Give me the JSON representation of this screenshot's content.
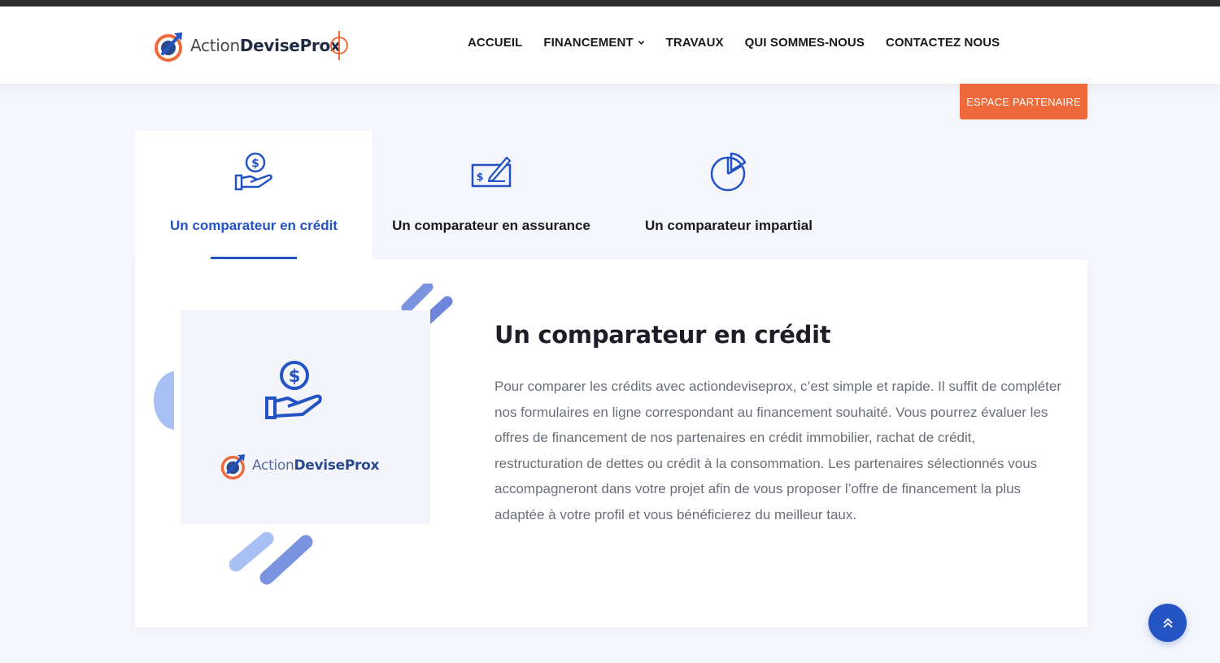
{
  "site": {
    "logo_text_light": "Action",
    "logo_text_bold": "DeviseProx"
  },
  "nav": {
    "items": [
      {
        "label": "ACCUEIL",
        "dropdown": false
      },
      {
        "label": "FINANCEMENT",
        "dropdown": true
      },
      {
        "label": "TRAVAUX",
        "dropdown": false
      },
      {
        "label": "QUI SOMMES-NOUS",
        "dropdown": false
      },
      {
        "label": "CONTACTEZ NOUS",
        "dropdown": false
      }
    ]
  },
  "partner_button": {
    "label": "ESPACE PARTENAIRE"
  },
  "tabs": [
    {
      "label": "Un comparateur en crédit",
      "icon": "hand-dollar-icon",
      "active": true
    },
    {
      "label": "Un comparateur en assurance",
      "icon": "cheque-icon",
      "active": false
    },
    {
      "label": "Un comparateur impartial",
      "icon": "pie-chart-icon",
      "active": false
    }
  ],
  "panel": {
    "title": "Un comparateur en crédit",
    "body": "Pour comparer les crédits avec actiondeviseprox, c’est simple et rapide. Il suffit de compléter nos formulaires en ligne correspondant au financement souhaité. Vous pourrez évaluer les offres de financement de nos partenaires en crédit immobilier, rachat de crédit, restructuration de dettes ou crédit à la consommation. Les partenaires sélectionnés vous accompagneront dans votre projet afin de vous proposer l’offre de financement la plus adaptée à votre profil et vous bénéficierez du meilleur taux.",
    "card_icon": "hand-dollar-icon"
  },
  "colors": {
    "accent_blue": "#2453c4",
    "accent_orange": "#ef6a3a",
    "dark_bar": "#2e2e2e"
  },
  "scroll_top": {
    "icon": "double-chevron-up-icon"
  }
}
